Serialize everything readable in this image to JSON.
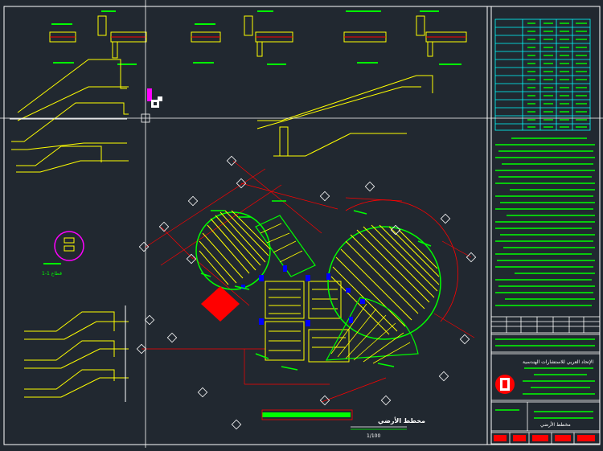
{
  "app": {
    "title": "Structural drawing — foundation / slab layout",
    "background": "#212830"
  },
  "colors": {
    "frame": "#ffffff",
    "structure": "#ffff00",
    "text": "#00ff00",
    "dimension": "#ff0000",
    "columns": "#0000ff",
    "highlight": "#ff0000",
    "annotation": "#ff00ff",
    "table": "#00ffff"
  },
  "drawing": {
    "main_title": "مخطط الأرضي",
    "main_scale": "1/100",
    "section_label": "قطاع 1-1",
    "title_block_company": "الإتحاد العربي للاستشارات الهندسية",
    "title_block_sheet": "مخطط الأرضي"
  },
  "cursor": {
    "crosshair": "crosshair",
    "pickbox": "pickbox"
  },
  "icons": {
    "logo": "company-logo",
    "cursor": "crosshair-cursor"
  }
}
